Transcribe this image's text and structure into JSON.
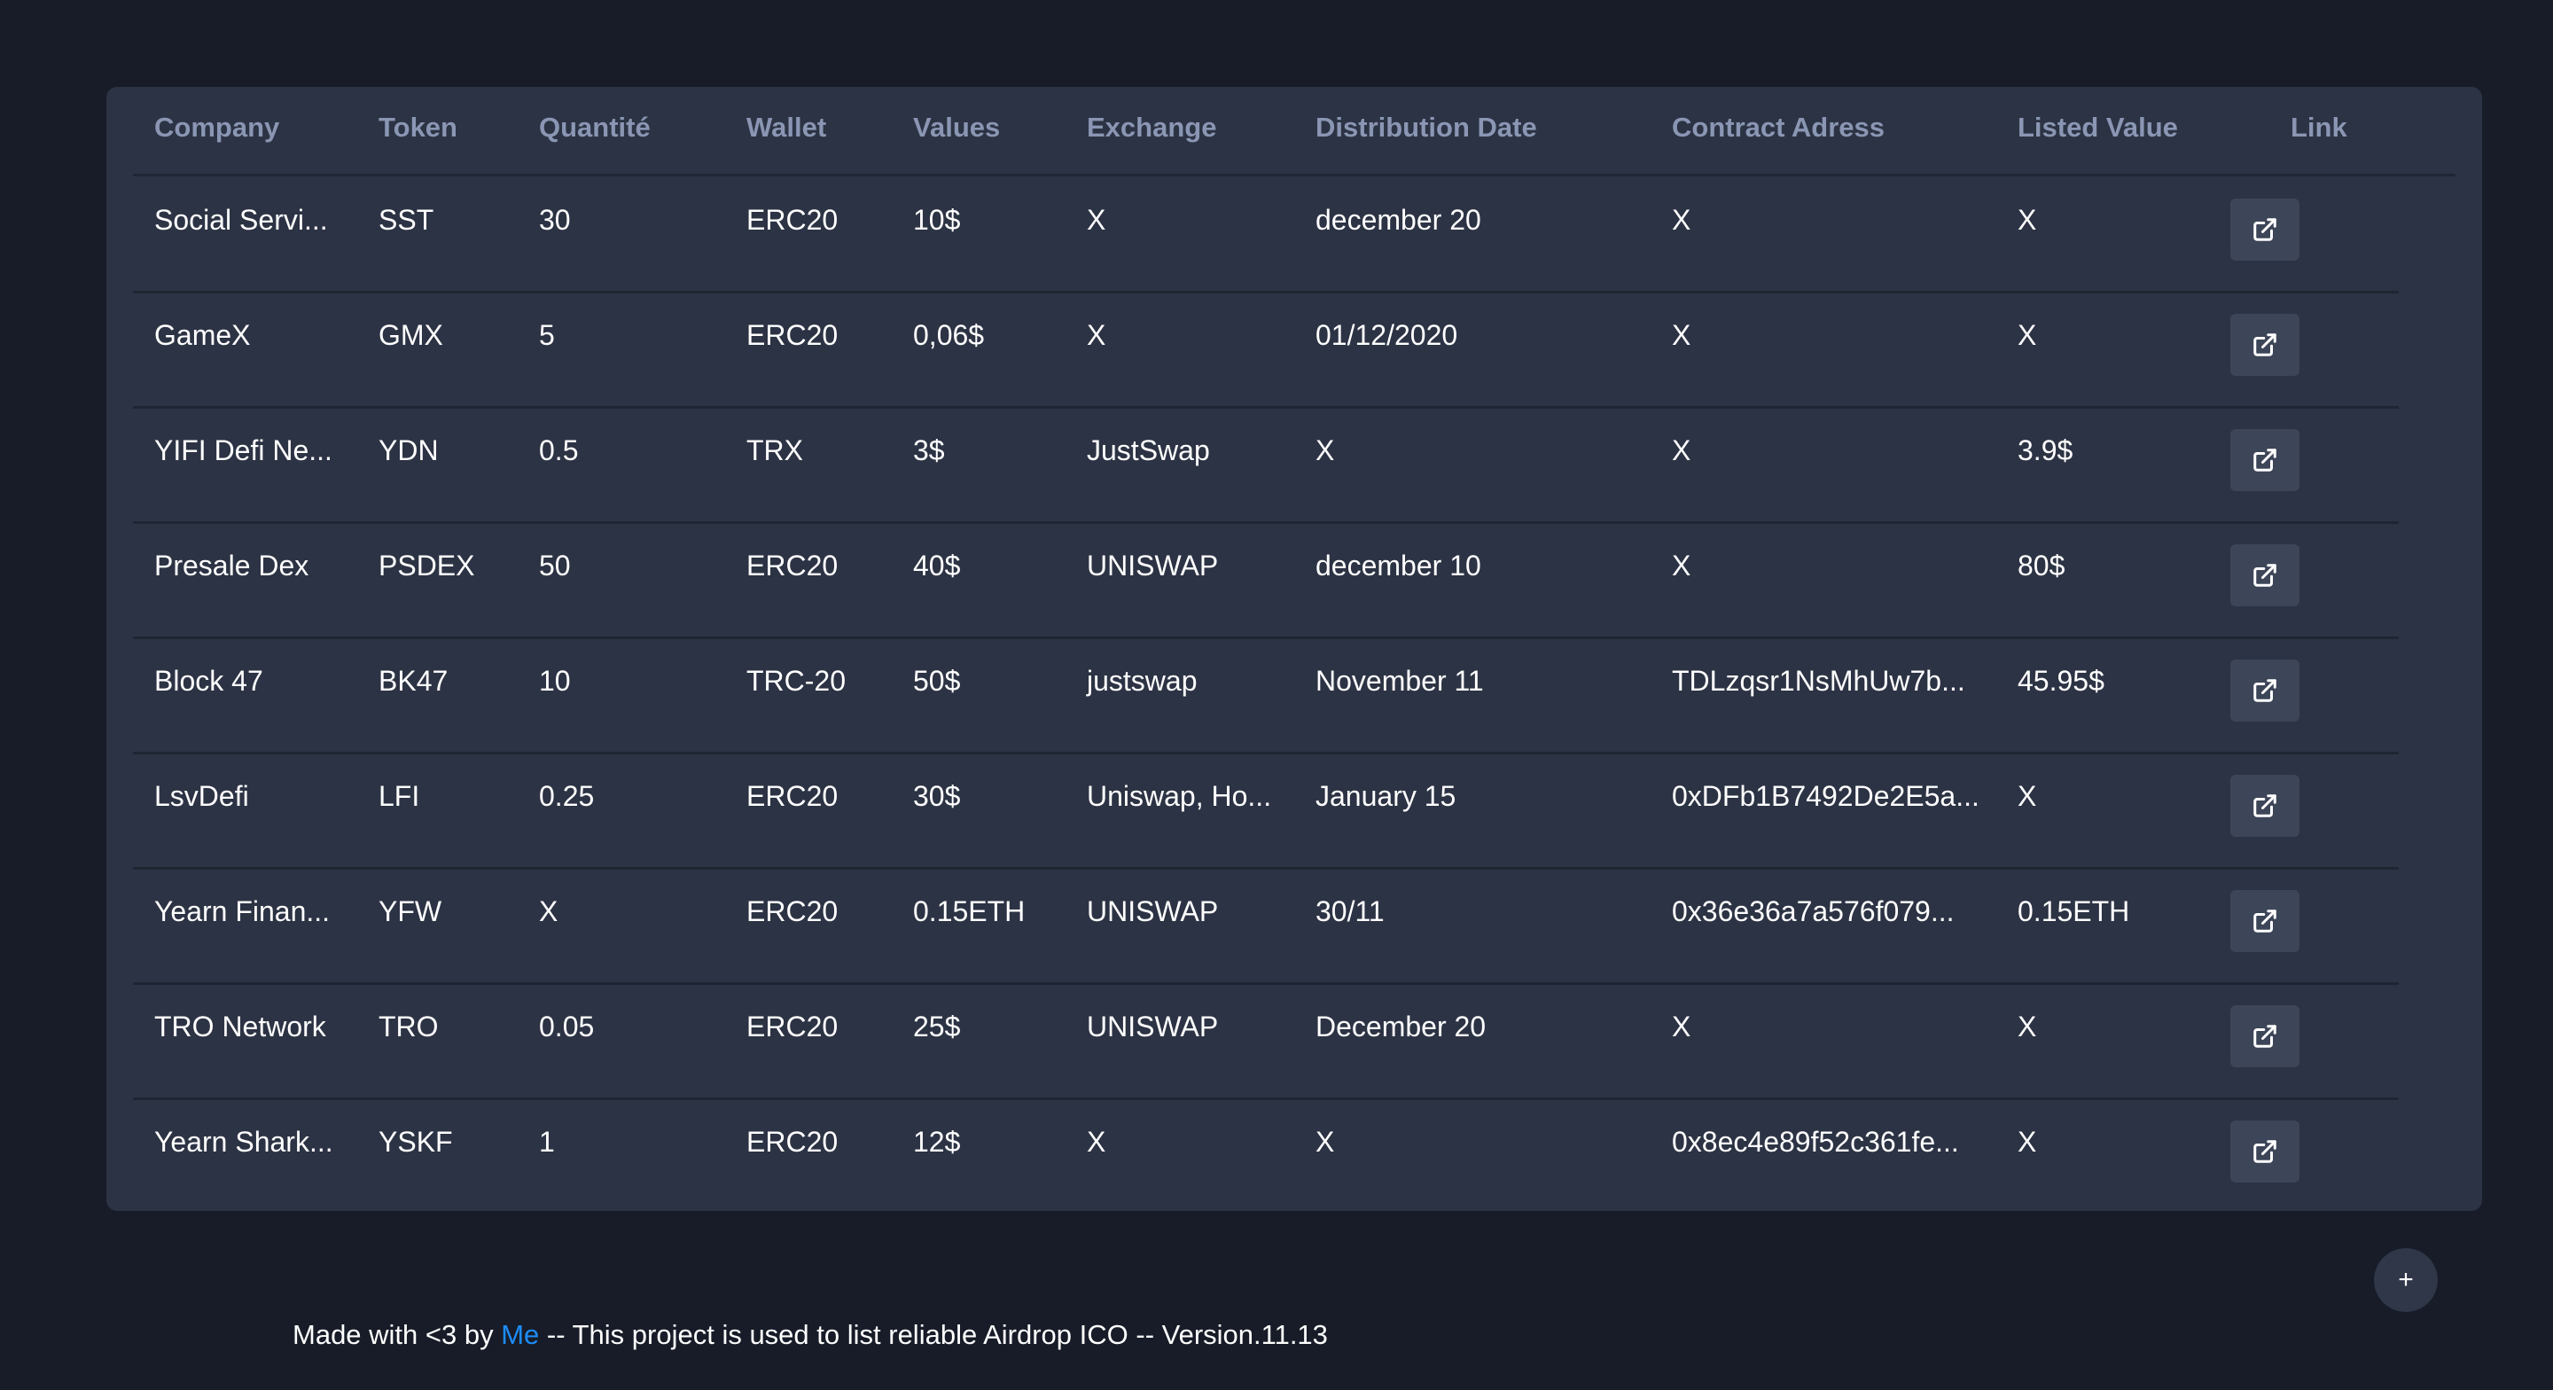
{
  "table": {
    "headers": [
      "Company",
      "Token",
      "Quantité",
      "Wallet",
      "Values",
      "Exchange",
      "Distribution Date",
      "Contract Adress",
      "Listed Value",
      "Link"
    ],
    "rows": [
      [
        "Social Servi...",
        "SST",
        "30",
        "ERC20",
        "10$",
        "X",
        "december 20",
        "X",
        "X"
      ],
      [
        "GameX",
        "GMX",
        "5",
        "ERC20",
        "0,06$",
        "X",
        "01/12/2020",
        "X",
        "X"
      ],
      [
        "YIFI Defi Ne...",
        "YDN",
        "0.5",
        "TRX",
        "3$",
        "JustSwap",
        "X",
        "X",
        "3.9$"
      ],
      [
        "Presale Dex",
        "PSDEX",
        "50",
        "ERC20",
        "40$",
        "UNISWAP",
        "december 10",
        "X",
        "80$"
      ],
      [
        "Block 47",
        "BK47",
        "10",
        "TRC-20",
        "50$",
        "justswap",
        "November 11",
        "TDLzqsr1NsMhUw7b...",
        "45.95$"
      ],
      [
        "LsvDefi",
        "LFI",
        "0.25",
        "ERC20",
        "30$",
        "Uniswap, Ho...",
        "January 15",
        "0xDFb1B7492De2E5a...",
        "X"
      ],
      [
        "Yearn Finan...",
        "YFW",
        "X",
        "ERC20",
        "0.15ETH",
        "UNISWAP",
        "30/11",
        "0x36e36a7a576f079...",
        "0.15ETH"
      ],
      [
        "TRO Network",
        "TRO",
        "0.05",
        "ERC20",
        "25$",
        "UNISWAP",
        "December 20",
        "X",
        "X"
      ],
      [
        "Yearn Shark...",
        "YSKF",
        "1",
        "ERC20",
        "12$",
        "X",
        "X",
        "0x8ec4e89f52c361fe...",
        "X"
      ]
    ],
    "link_icon": "external-link-icon"
  },
  "fab": {
    "label": "+",
    "icon": "plus-icon"
  },
  "footer": {
    "prefix": "Made with <3 by ",
    "link_text": "Me",
    "suffix": " -- This project is used to list reliable Airdrop ICO -- Version.11.13"
  },
  "colors": {
    "background": "#171c28",
    "panel": "#2c3344",
    "header_text": "#8a96b3",
    "button": "#3d4558",
    "link": "#1d8cf8"
  }
}
